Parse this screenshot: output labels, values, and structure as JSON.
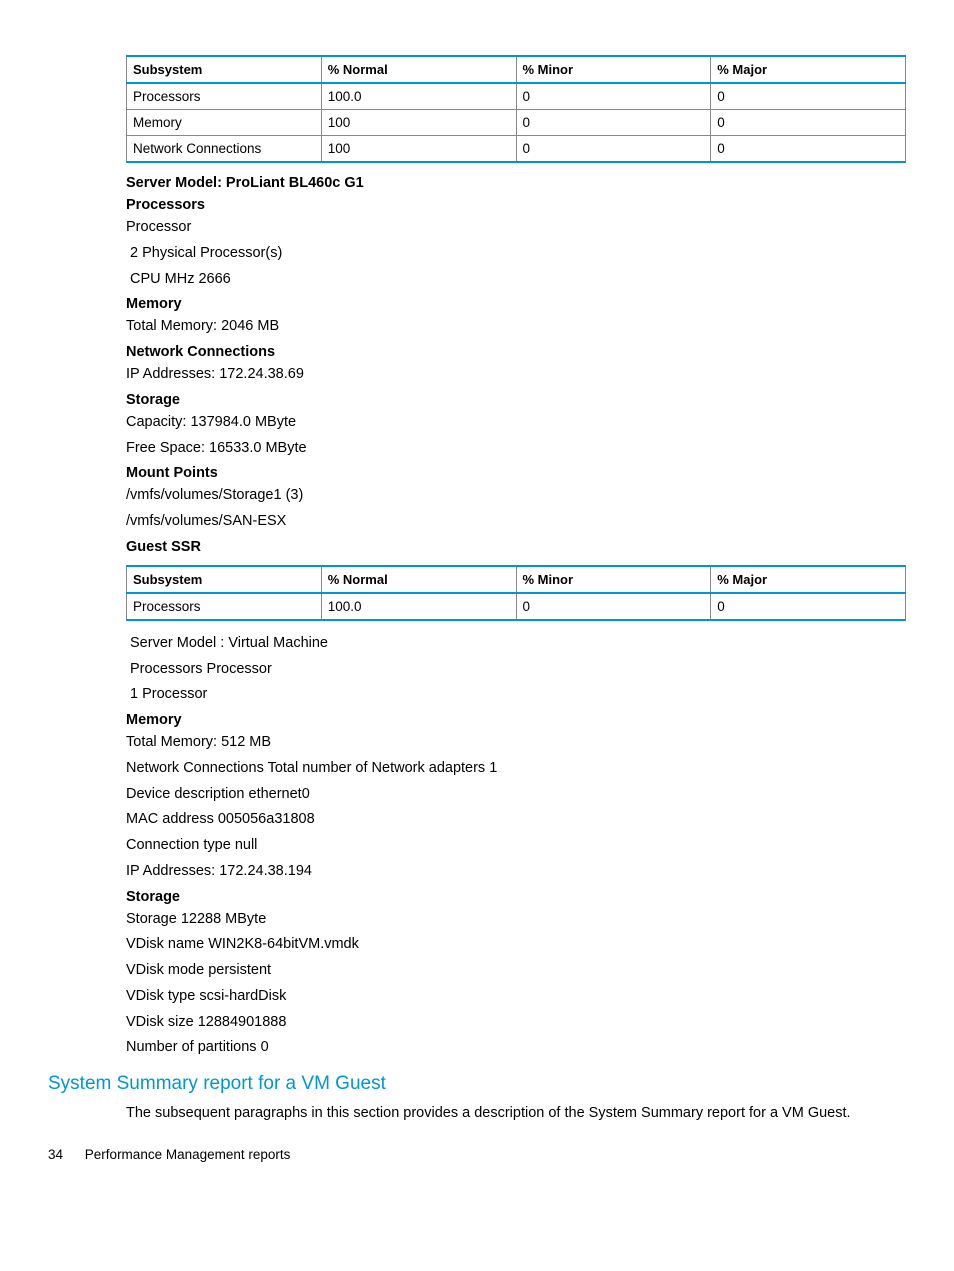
{
  "table1": {
    "headers": [
      "Subsystem",
      "% Normal",
      "% Minor",
      "% Major"
    ],
    "rows": [
      [
        "Processors",
        "100.0",
        "0",
        "0"
      ],
      [
        "Memory",
        "100",
        "0",
        "0"
      ],
      [
        "Network Connections",
        "100",
        "0",
        "0"
      ]
    ]
  },
  "host": {
    "server_model": "Server Model: ProLiant BL460c G1",
    "processors_heading": "Processors",
    "processor_label": "Processor",
    "physical_processors": " 2 Physical Processor(s)",
    "cpu_mhz": " CPU MHz 2666",
    "memory_heading": "Memory",
    "total_memory": "Total Memory: 2046 MB",
    "network_heading": "Network Connections",
    "ip_addresses": "IP Addresses: 172.24.38.69",
    "storage_heading": "Storage",
    "capacity": "Capacity: 137984.0 MByte",
    "free_space": "Free Space: 16533.0 MByte",
    "mount_points_heading": "Mount Points",
    "mount1": "/vmfs/volumes/Storage1 (3)",
    "mount2": "/vmfs/volumes/SAN-ESX",
    "guest_ssr_heading": "Guest SSR"
  },
  "table2": {
    "headers": [
      "Subsystem",
      "% Normal",
      "% Minor",
      "% Major"
    ],
    "rows": [
      [
        "Processors",
        "100.0",
        "0",
        "0"
      ]
    ]
  },
  "guest": {
    "server_model": " Server Model : Virtual Machine",
    "processors_label": " Processors Processor",
    "one_processor": " 1 Processor",
    "memory_heading": "Memory",
    "total_memory": "Total Memory: 512 MB",
    "network_adapters": "Network Connections Total number of Network adapters 1",
    "device_desc": "Device description ethernet0",
    "mac_address": "MAC address 005056a31808",
    "connection_type": "Connection type null",
    "ip_addresses": "IP Addresses: 172.24.38.194",
    "storage_heading": "Storage",
    "storage_size": "Storage 12288 MByte",
    "vdisk_name": "VDisk name WIN2K8-64bitVM.vmdk",
    "vdisk_mode": "VDisk mode persistent",
    "vdisk_type": "VDisk type scsi-hardDisk",
    "vdisk_size": "VDisk size 12884901888",
    "num_partitions": "Number of partitions 0"
  },
  "section_heading": "System Summary report for a VM Guest",
  "section_para": "The subsequent paragraphs in this section provides a description of the System Summary report for a VM Guest.",
  "footer": {
    "page": "34",
    "title": "Performance Management reports"
  }
}
